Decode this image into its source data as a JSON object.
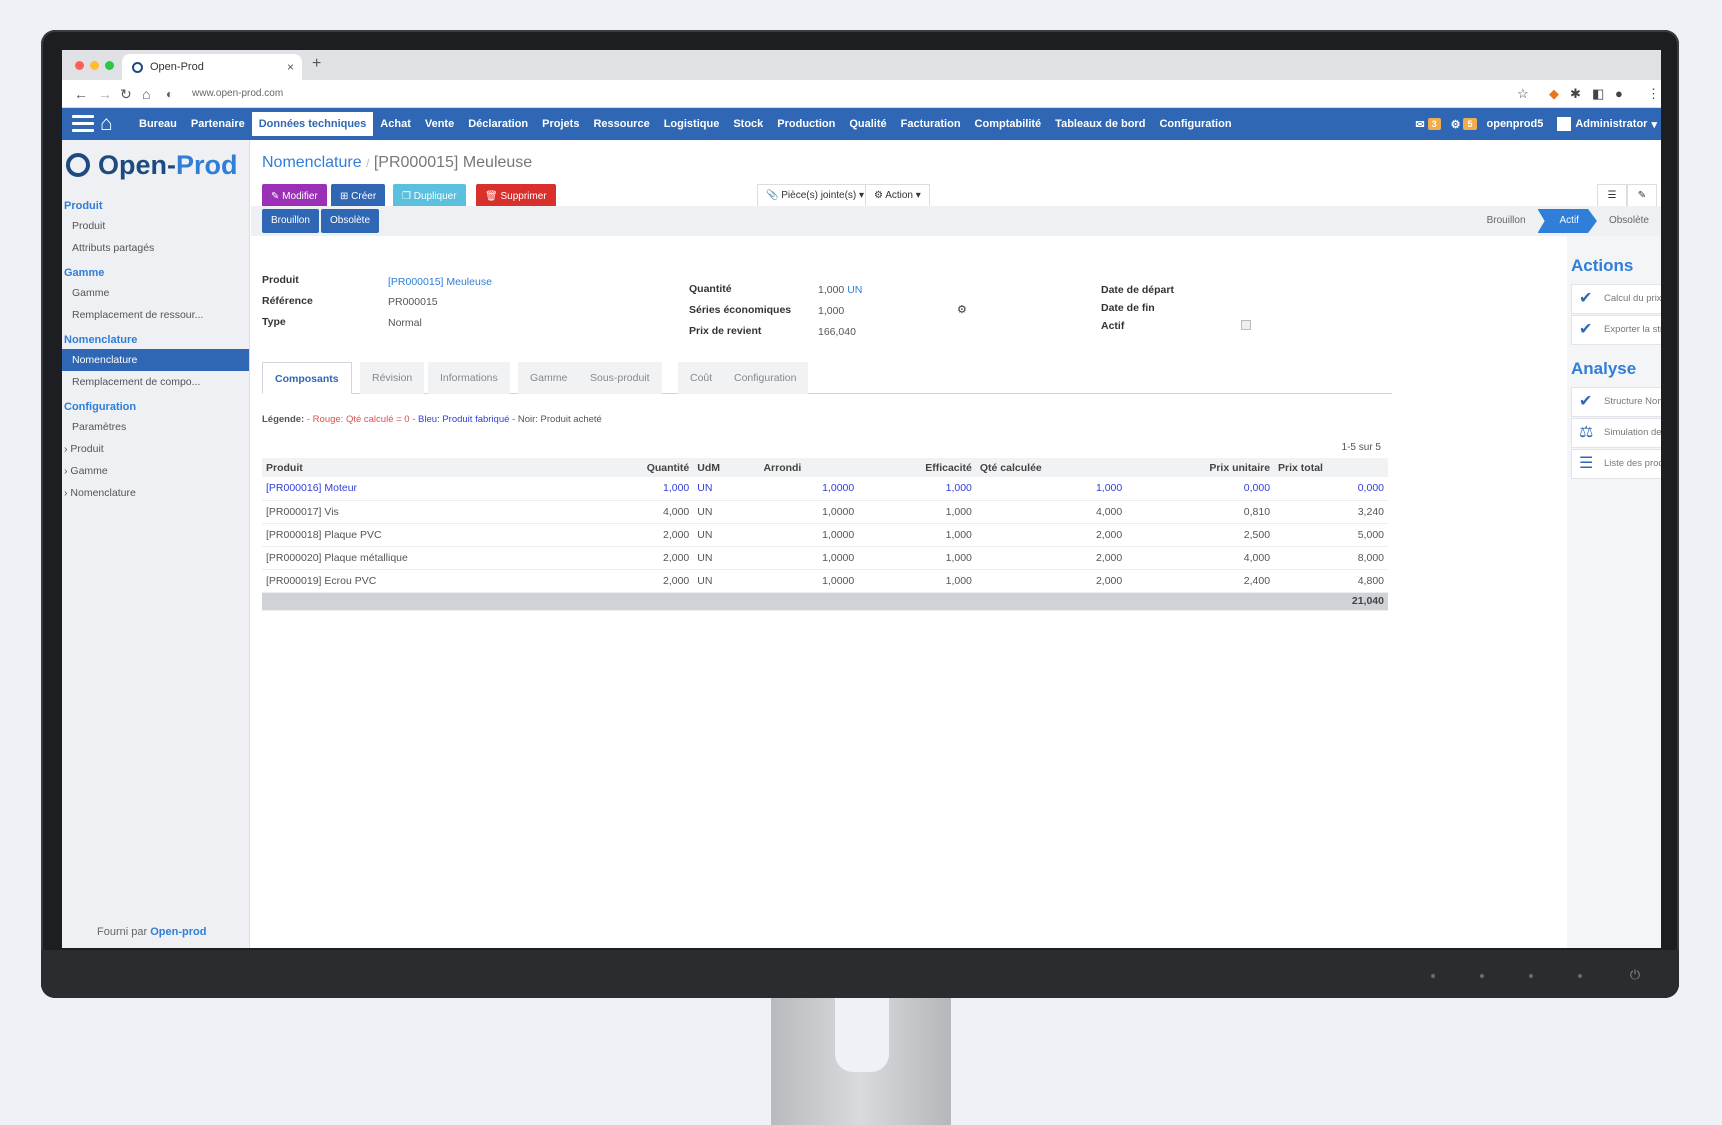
{
  "browser": {
    "tab_title": "Open-Prod",
    "url": "www.open-prod.com"
  },
  "nav": {
    "menu": [
      "Bureau",
      "Partenaire",
      "Données techniques",
      "Achat",
      "Vente",
      "Déclaration",
      "Projets",
      "Ressource",
      "Logistique",
      "Stock",
      "Production",
      "Qualité",
      "Facturation",
      "Comptabilité",
      "Tableaux de bord",
      "Configuration"
    ],
    "active": "Données techniques",
    "messages_count": "3",
    "activities_count": "5",
    "db_name": "openprod5",
    "user": "Administrator"
  },
  "sidebar": {
    "logo_a": "Open-",
    "logo_b": "Prod",
    "groups": [
      {
        "title": "Produit",
        "items": [
          "Produit",
          "Attributs partagés"
        ]
      },
      {
        "title": "Gamme",
        "items": [
          "Gamme",
          "Remplacement de ressour..."
        ]
      },
      {
        "title": "Nomenclature",
        "items": [
          "Nomenclature",
          "Remplacement de compo..."
        ]
      },
      {
        "title": "Configuration",
        "items": [
          "Paramètres",
          "Produit",
          "Gamme",
          "Nomenclature"
        ]
      }
    ],
    "active_item": "Nomenclature",
    "footer_text": "Fourni par",
    "footer_link": "Open-prod"
  },
  "breadcrumb": {
    "parent": "Nomenclature",
    "separator": "/",
    "current": "[PR000015] Meuleuse"
  },
  "buttons": {
    "edit": "Modifier",
    "create": "Créer",
    "duplicate": "Dupliquer",
    "delete": "Supprimer",
    "attachments": "Pièce(s) jointe(s)",
    "action": "Action",
    "edit_color": "#9b30b6",
    "create_color": "#2f67b4",
    "duplicate_color": "#5bc0de",
    "delete_color": "#d9302c"
  },
  "status": {
    "buttons": [
      "Brouillon",
      "Obsolète"
    ],
    "stages": [
      "Brouillon",
      "Actif",
      "Obsolète"
    ],
    "current_stage": "Actif"
  },
  "form": {
    "product_label": "Produit",
    "product_value": "[PR000015] Meuleuse",
    "reference_label": "Référence",
    "reference_value": "PR000015",
    "type_label": "Type",
    "type_value": "Normal",
    "qty_label": "Quantité",
    "qty_value": "1,000",
    "qty_unit": "UN",
    "eco_label": "Séries économiques",
    "eco_value": "1,000",
    "cost_label": "Prix de revient",
    "cost_value": "166,040",
    "start_label": "Date de départ",
    "end_label": "Date de fin",
    "active_label": "Actif"
  },
  "tabs": [
    "Composants",
    "Révision",
    "Informations",
    "Gamme",
    "Sous-produit",
    "Coût",
    "Configuration"
  ],
  "active_tab": "Composants",
  "legend": {
    "label": "Légende:",
    "red": "- Rouge: Qté calculé = 0 -",
    "blue": "Bleu: Produit fabriqué",
    "black": "- Noir: Produit acheté"
  },
  "pager": "1-5 sur 5",
  "table": {
    "headers": [
      "Produit",
      "Quantité",
      "UdM",
      "Arrondi",
      "Efficacité",
      "Qté calculée",
      "Prix unitaire",
      "Prix total"
    ],
    "rows": [
      [
        "[PR000016] Moteur",
        "1,000",
        "UN",
        "1,0000",
        "1,000",
        "1,000",
        "0,000",
        "0,000"
      ],
      [
        "[PR000017] Vis",
        "4,000",
        "UN",
        "1,0000",
        "1,000",
        "4,000",
        "0,810",
        "3,240"
      ],
      [
        "[PR000018] Plaque PVC",
        "2,000",
        "UN",
        "1,0000",
        "1,000",
        "2,000",
        "2,500",
        "5,000"
      ],
      [
        "[PR000020] Plaque métallique",
        "2,000",
        "UN",
        "1,0000",
        "1,000",
        "2,000",
        "4,000",
        "8,000"
      ],
      [
        "[PR000019] Ecrou PVC",
        "2,000",
        "UN",
        "1,0000",
        "1,000",
        "2,000",
        "2,400",
        "4,800"
      ]
    ],
    "total": "21,040"
  },
  "right_panel": {
    "actions_title": "Actions",
    "actions": [
      "Calcul du prix",
      "Exporter la structure"
    ],
    "analysis_title": "Analyse",
    "analysis": [
      "Structure Nomenclature",
      "Simulation de coût",
      "Liste des produits"
    ]
  }
}
